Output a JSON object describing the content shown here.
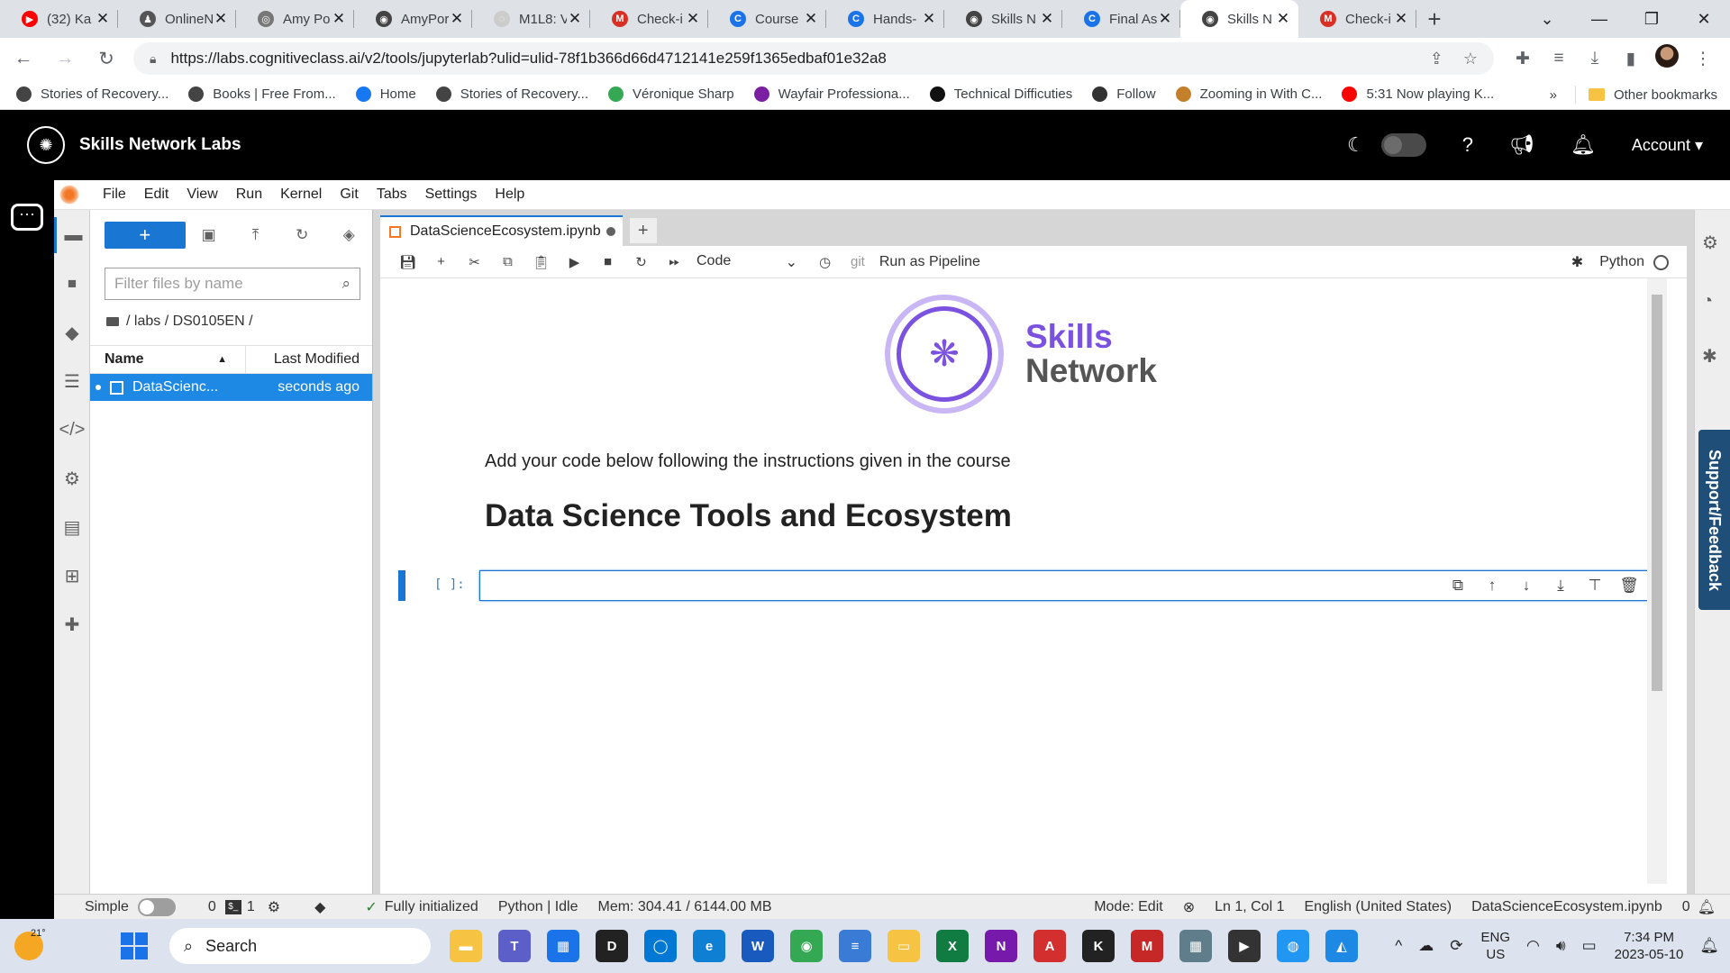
{
  "browser": {
    "tabs": [
      {
        "title": "(32) Ka",
        "favicon_color": "#ff0000",
        "favicon_glyph": "▶"
      },
      {
        "title": "OnlineN",
        "favicon_color": "#555555",
        "favicon_glyph": "♟"
      },
      {
        "title": "Amy Po",
        "favicon_color": "#777777",
        "favicon_glyph": "◎"
      },
      {
        "title": "AmyPor",
        "favicon_color": "#444444",
        "favicon_glyph": "◉"
      },
      {
        "title": "M1L8: V",
        "favicon_color": "#cccccc",
        "favicon_glyph": "◌"
      },
      {
        "title": "Check-i",
        "favicon_color": "#d93025",
        "favicon_glyph": "M"
      },
      {
        "title": "Course",
        "favicon_color": "#1a73e8",
        "favicon_glyph": "C"
      },
      {
        "title": "Hands-",
        "favicon_color": "#1a73e8",
        "favicon_glyph": "C"
      },
      {
        "title": "Skills N",
        "favicon_color": "#444444",
        "favicon_glyph": "◉"
      },
      {
        "title": "Final As",
        "favicon_color": "#1a73e8",
        "favicon_glyph": "C"
      },
      {
        "title": "Skills N",
        "favicon_color": "#444444",
        "favicon_glyph": "◉",
        "active": true
      },
      {
        "title": "Check-i",
        "favicon_color": "#d93025",
        "favicon_glyph": "M"
      }
    ],
    "url": "https://labs.cognitiveclass.ai/v2/tools/jupyterlab?ulid=ulid-78f1b366d66d4712141e259f1365edbaf01e32a8",
    "bookmarks": [
      {
        "label": "Stories of Recovery...",
        "color": "#444444"
      },
      {
        "label": "Books | Free From...",
        "color": "#444444"
      },
      {
        "label": "Home",
        "color": "#1877f2"
      },
      {
        "label": "Stories of Recovery...",
        "color": "#444444"
      },
      {
        "label": "Véronique Sharp",
        "color": "#34a853"
      },
      {
        "label": "Wayfair Professiona...",
        "color": "#7b1fa2"
      },
      {
        "label": "Technical Difficuties",
        "color": "#111111"
      },
      {
        "label": "Follow",
        "color": "#333333"
      },
      {
        "label": "Zooming in With C...",
        "color": "#c47f2a"
      },
      {
        "label": "5:31 Now playing K...",
        "color": "#ff0000"
      }
    ],
    "bookmarks_overflow": "»",
    "other_bookmarks": "Other bookmarks"
  },
  "sn_header": {
    "title": "Skills Network Labs",
    "account": "Account"
  },
  "menu": [
    "File",
    "Edit",
    "View",
    "Run",
    "Kernel",
    "Git",
    "Tabs",
    "Settings",
    "Help"
  ],
  "filebrowser": {
    "filter_placeholder": "Filter files by name",
    "breadcrumb": "/ labs / DS0105EN /",
    "col_name": "Name",
    "col_modified": "Last Modified",
    "files": [
      {
        "name": "DataScienc...",
        "modified": "seconds ago"
      }
    ]
  },
  "notebook": {
    "tab_title": "DataScienceEcosystem.ipynb",
    "cell_type": "Code",
    "git_label": "git",
    "run_pipeline": "Run as Pipeline",
    "kernel": "Python",
    "brand_line1": "Skills",
    "brand_line2": "Network",
    "markdown_text": "Add your code below following the instructions given in the course",
    "heading": "Data Science Tools and Ecosystem",
    "prompt": "[ ]:"
  },
  "support_label": "Support/Feedback",
  "statusbar": {
    "mode_label": "Simple",
    "count_a": "0",
    "count_b": "1",
    "init_status": "Fully initialized",
    "kernel_status": "Python | Idle",
    "memory": "Mem: 304.41 / 6144.00 MB",
    "mode": "Mode: Edit",
    "position": "Ln 1, Col 1",
    "language": "English (United States)",
    "filename": "DataScienceEcosystem.ipynb",
    "notifications": "0"
  },
  "taskbar": {
    "temperature": "21°",
    "search": "Search",
    "lang_line1": "ENG",
    "lang_line2": "US",
    "time": "7:34 PM",
    "date": "2023-05-10",
    "apps": [
      {
        "name": "folder-app",
        "color": "#f6c342",
        "glyph": "▬"
      },
      {
        "name": "teams-app",
        "color": "#5b5fc7",
        "glyph": "T"
      },
      {
        "name": "store-app",
        "color": "#1a73e8",
        "glyph": "▦"
      },
      {
        "name": "dell-app",
        "color": "#222222",
        "glyph": "D"
      },
      {
        "name": "app-blue",
        "color": "#0078d4",
        "glyph": "◯"
      },
      {
        "name": "edge-app",
        "color": "#0f7fd4",
        "glyph": "e"
      },
      {
        "name": "word-app",
        "color": "#185abd",
        "glyph": "W"
      },
      {
        "name": "chrome-app",
        "color": "#34a853",
        "glyph": "◉"
      },
      {
        "name": "notepad-app",
        "color": "#3a7bd5",
        "glyph": "≡"
      },
      {
        "name": "explorer-app",
        "color": "#f6c342",
        "glyph": "▭"
      },
      {
        "name": "excel-app",
        "color": "#107c41",
        "glyph": "X"
      },
      {
        "name": "onenote-app",
        "color": "#7719aa",
        "glyph": "N"
      },
      {
        "name": "acrobat-app",
        "color": "#d32f2f",
        "glyph": "A"
      },
      {
        "name": "app-k",
        "color": "#222222",
        "glyph": "K"
      },
      {
        "name": "mcafee-app",
        "color": "#c62828",
        "glyph": "M"
      },
      {
        "name": "calculator-app",
        "color": "#607d8b",
        "glyph": "▦"
      },
      {
        "name": "media-app",
        "color": "#333333",
        "glyph": "▶"
      },
      {
        "name": "app-globe",
        "color": "#2196f3",
        "glyph": "◍"
      },
      {
        "name": "app-photos",
        "color": "#1e88e5",
        "glyph": "◭"
      }
    ]
  }
}
